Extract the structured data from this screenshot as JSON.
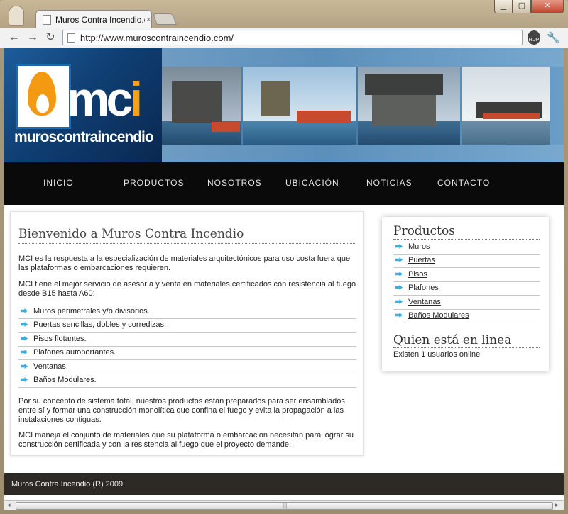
{
  "browser": {
    "tab_title": "Muros Contra Incendio.co",
    "tab_close": "×",
    "url": "http://www.muroscontraincendio.com/",
    "rdp_label": "RDP",
    "win_min": "▁",
    "win_max": "▢",
    "win_close": "✕",
    "nav_back": "←",
    "nav_forward": "→",
    "nav_reload": "↻",
    "wrench": "🔧",
    "scroll_grip": "|||",
    "scroll_left": "◂",
    "scroll_right": "▸"
  },
  "brand": {
    "mark_main": "mc",
    "mark_accent": "i",
    "wordmark": "muroscontraincendio"
  },
  "nav": [
    "INICIO",
    "PRODUCTOS",
    "NOSOTROS",
    "UBICACIÓN",
    "NOTICIAS",
    "CONTACTO"
  ],
  "main": {
    "title": "Bienvenido a Muros Contra Incendio",
    "intro_1": "MCI es la respuesta a la especialización de materiales arquitectónicos para uso costa fuera que las plataformas o embarcaciones requieren.",
    "intro_2": "MCI tiene el mejor servicio de asesoría y venta en materiales certificados con resistencia al fuego desde B15 hasta A60:",
    "list": [
      "Muros perimetrales y/o divisorios.",
      "Puertas sencillas, dobles y corredizas.",
      "Pisos flotantes.",
      "Plafones autoportantes.",
      "Ventanas.",
      "Baños Modulares."
    ],
    "para_3": "Por su concepto de sistema total, nuestros productos están preparados para ser ensamblados entre sí y formar una construcción monolítica que confina el fuego y evita la propagación a las instalaciones contiguas.",
    "para_4": "MCI maneja el conjunto de materiales que su plataforma o embarcación necesitan para lograr su construcción certificada y con la resistencia al fuego que el proyecto demande."
  },
  "sidebar": {
    "products_title": "Productos",
    "products": [
      "Muros",
      "Puertas",
      "Pisos",
      "Plafones",
      "Ventanas",
      "Baños Modulares"
    ],
    "online_title": "Quien está en linea",
    "online_text": "Existen 1 usuarios online"
  },
  "footer": {
    "text": "Muros Contra Incendio (R) 2009"
  },
  "colors": {
    "accent_orange": "#f49a12",
    "brand_blue": "#1b6ab1",
    "nav_bg": "#0a0a0a",
    "footer_bg": "#2d2a26",
    "bullet_blue": "#3aaee0"
  }
}
